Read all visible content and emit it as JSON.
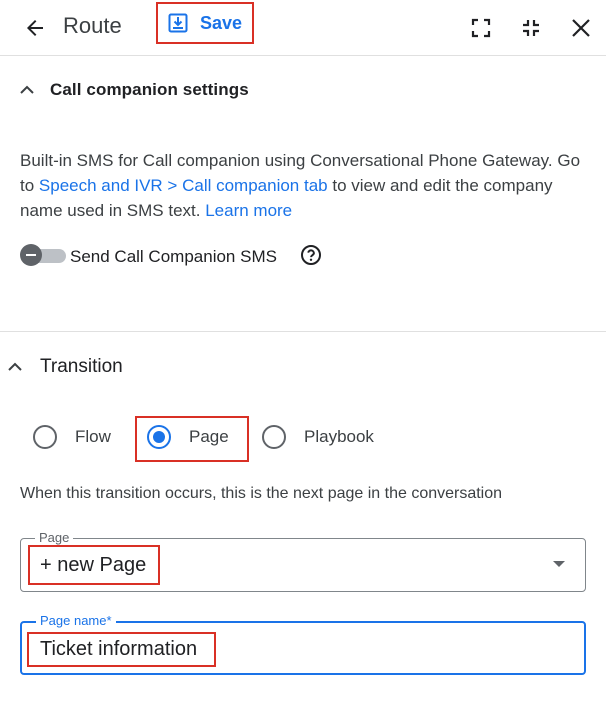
{
  "header": {
    "title": "Route",
    "save_label": "Save"
  },
  "call_companion": {
    "heading": "Call companion settings",
    "desc_text_1": "Built-in SMS for Call companion using Conversational Phone Gateway. Go to ",
    "desc_link_1": "Speech and IVR > Call companion tab",
    "desc_text_2": " to view and edit the company name used in SMS text. ",
    "desc_link_2": "Learn more",
    "toggle_label": "Send Call Companion SMS",
    "toggle_on": false
  },
  "transition": {
    "heading": "Transition",
    "options": [
      {
        "label": "Flow",
        "selected": false
      },
      {
        "label": "Page",
        "selected": true
      },
      {
        "label": "Playbook",
        "selected": false
      }
    ],
    "hint": "When this transition occurs, this is the next page in the conversation",
    "page_field": {
      "label": "Page",
      "value": "+ new Page"
    },
    "page_name_field": {
      "label": "Page name*",
      "value": "Ticket information"
    }
  },
  "colors": {
    "accent": "#1a73e8",
    "highlight": "#d93025",
    "divider": "#e0e0e0"
  }
}
